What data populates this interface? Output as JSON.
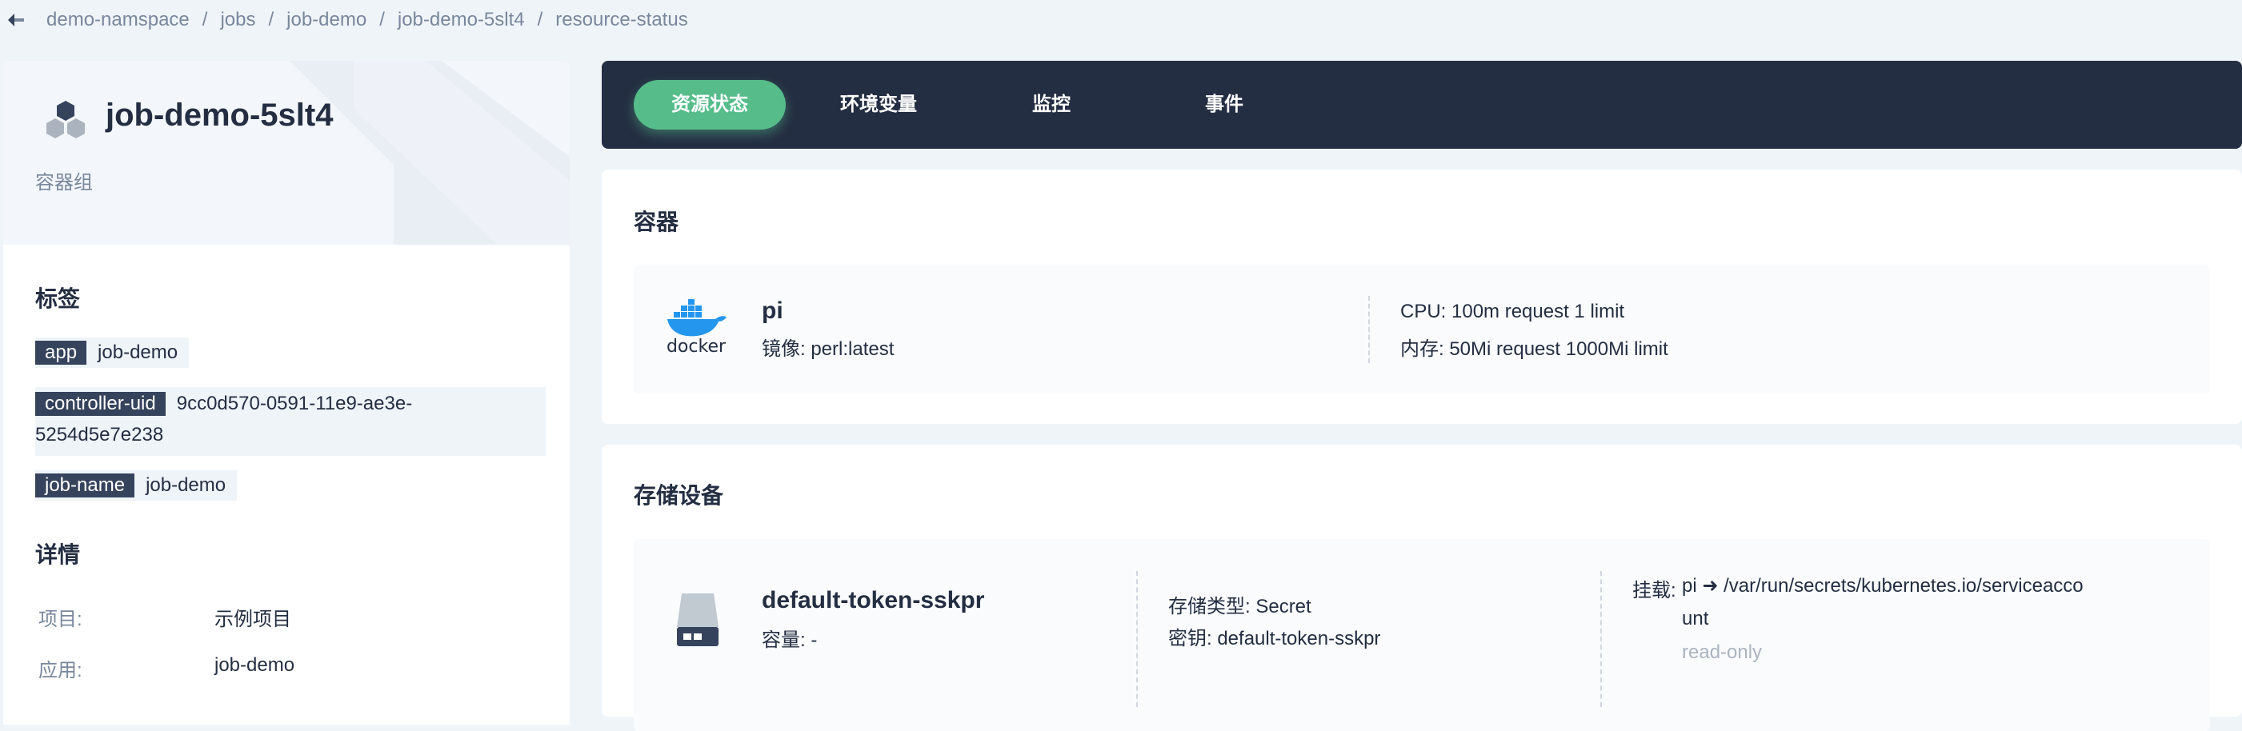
{
  "breadcrumb": [
    "demo-namspace",
    "jobs",
    "job-demo",
    "job-demo-5slt4",
    "resource-status"
  ],
  "resource": {
    "name": "job-demo-5slt4",
    "type": "容器组"
  },
  "labels": {
    "title": "标签",
    "items": [
      {
        "key": "app",
        "value": "job-demo"
      },
      {
        "key": "controller-uid",
        "value_line1": "9cc0d570-0591-11e9-ae3e-",
        "value_line2": "5254d5e7e238"
      },
      {
        "key": "job-name",
        "value": "job-demo"
      }
    ]
  },
  "details": {
    "title": "详情",
    "rows": [
      {
        "key": "项目:",
        "value": "示例项目"
      },
      {
        "key": "应用:",
        "value": "job-demo"
      }
    ]
  },
  "tabs": [
    "资源状态",
    "环境变量",
    "监控",
    "事件"
  ],
  "active_tab": "资源状态",
  "containers": {
    "title": "容器",
    "item": {
      "name": "pi",
      "image": "镜像: perl:latest",
      "logo_text": "docker",
      "cpu": "CPU: 100m request 1 limit",
      "memory": "内存: 50Mi request 1000Mi limit"
    }
  },
  "storage": {
    "title": "存储设备",
    "item": {
      "name": "default-token-sskpr",
      "capacity": "容量: -",
      "type": "存储类型: Secret",
      "secret": "密钥: default-token-sskpr",
      "mount_label": "挂载:",
      "mount_line1": "pi ➜ /var/run/secrets/kubernetes.io/serviceacco",
      "mount_line2": "unt",
      "mount_mode": "read-only"
    }
  },
  "colors": {
    "accent": "#55bc8a",
    "dark": "#242e42",
    "muted": "#79879c"
  }
}
